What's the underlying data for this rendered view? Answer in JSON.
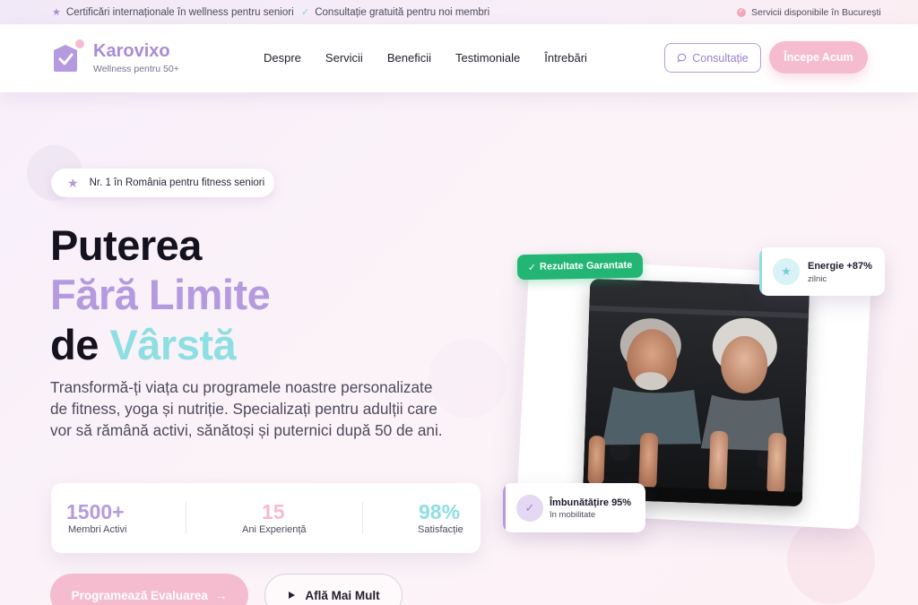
{
  "topbar": {
    "item1": "Certificări internaționale în wellness pentru seniori",
    "item2": "Consultație gratuită pentru noi membri",
    "location": "Servicii disponibile în București"
  },
  "brand": {
    "name": "Karovixo",
    "tagline": "Wellness pentru 50+"
  },
  "nav": [
    "Despre",
    "Servicii",
    "Beneficii",
    "Testimoniale",
    "Întrebări"
  ],
  "header": {
    "consult_label": "Consultație",
    "start_label": "Începe Acum"
  },
  "hero": {
    "badge": "Nr. 1 în România pentru fitness seniori",
    "title_line1": "Puterea",
    "title_line2": "Fără Limite",
    "title_line3_prefix": "de ",
    "title_line3_accent": "Vârstă",
    "description": "Transformă-ți viața cu programele noastre personalizate de fitness, yoga și nutriție. Specializați pentru adulții care vor să rămână activi, sănătoși și puternici după 50 de ani.",
    "stats": [
      {
        "value": "1500+",
        "label": "Membri Activi",
        "color": "#b59ae0"
      },
      {
        "value": "15",
        "label": "Ani Experiență",
        "color": "#f5bcd0"
      },
      {
        "value": "98%",
        "label": "Satisfacție",
        "color": "#8edfe3"
      }
    ],
    "cta_primary": "Programează Evaluarea",
    "cta_secondary": "Află Mai Mult"
  },
  "visual": {
    "tag": "Rezultate Garantate",
    "card_energy": {
      "title": "Energie +87%",
      "subtitle": "zilnic"
    },
    "card_mobility": {
      "title": "Îmbunătățire 95%",
      "subtitle": "în mobilitate"
    }
  },
  "colors": {
    "lavender": "#b59ae0",
    "pink": "#f5bcd0",
    "teal": "#8edfe3",
    "green": "#22b573",
    "dark": "#15121f"
  },
  "icons": [
    "star-icon",
    "check-icon",
    "location-icon",
    "logo-icon",
    "chat-icon",
    "arrow-right-icon",
    "play-icon"
  ]
}
